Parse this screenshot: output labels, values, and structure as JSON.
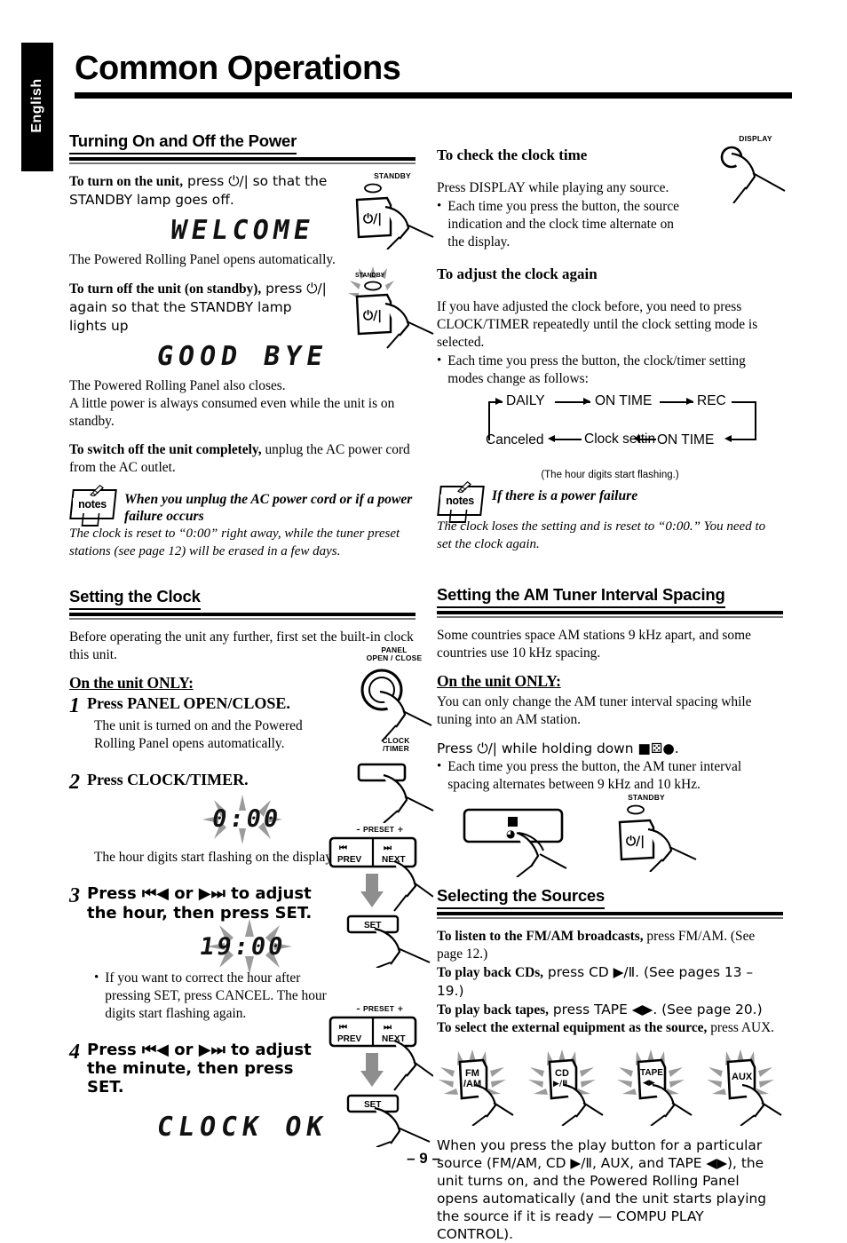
{
  "language_tab": "English",
  "page_title": "Common Operations",
  "page_number": "– 9 –",
  "left_column": {
    "section1": {
      "heading": "Turning On and Off the Power",
      "p1_bold": "To turn on the unit,",
      "p1_rest": " press  ⏻/| so that the STANDBY lamp goes off.",
      "lcd1": "WELCOME",
      "p2": "The Powered Rolling Panel opens automatically.",
      "p3_bold": "To turn off the unit (on standby),",
      "p3_rest": " press  ⏻/| again so that the STANDBY lamp lights up",
      "lcd2": "GOOD BYE",
      "p4": "The Powered Rolling Panel also closes.",
      "p5": "A little power is always consumed even while the unit is on standby.",
      "p6_bold": "To switch off the unit completely,",
      "p6_rest": " unplug the AC power cord from the AC outlet.",
      "note_label": "notes",
      "note_title": "When you unplug the AC power cord or if a power failure occurs",
      "note_body": "The clock is reset to “0:00” right away, while the tuner preset stations (see page 12) will be erased in a few days.",
      "illus_standby_on": "STANDBY",
      "illus_standby_off": "STANDBY"
    },
    "section2": {
      "heading": "Setting the Clock",
      "intro": "Before operating the unit any further, first set the built-in clock this unit.",
      "on_unit_only": "On the unit ONLY:",
      "steps": [
        {
          "num": "1",
          "title": "Press PANEL OPEN/CLOSE.",
          "body": "The unit is turned on and the Powered Rolling Panel opens automatically.",
          "illus_cap": "PANEL\nOPEN / CLOSE"
        },
        {
          "num": "2",
          "title": "Press CLOCK/TIMER.",
          "lcd": "0:00",
          "body": "The hour digits start flashing on the display.",
          "illus_cap": "CLOCK\n/TIMER"
        },
        {
          "num": "3",
          "title": "Press ⏮◀ or ▶⏭ to adjust the hour, then press SET.",
          "lcd": "19:00",
          "bullet": "If you want to correct the hour after pressing SET, press CANCEL. The hour digits start flashing again.",
          "illus_preset": "PRESET",
          "illus_prev": "PREV",
          "illus_next": "NEXT",
          "illus_set": "SET"
        },
        {
          "num": "4",
          "title": "Press  ⏮◀ or ▶⏭ to adjust the minute, then press SET.",
          "lcd": "CLOCK OK",
          "illus_preset": "PRESET",
          "illus_prev": "PREV",
          "illus_next": "NEXT",
          "illus_set": "SET"
        }
      ]
    }
  },
  "right_column": {
    "section1": {
      "heading": "To check the clock time",
      "p1": "Press DISPLAY while playing any source.",
      "bullet1": "Each time you press the button, the source indication and the clock time alternate on the display.",
      "illus_cap": "DISPLAY"
    },
    "section2": {
      "heading": "To adjust the clock again",
      "p1": "If you have adjusted the clock before, you need to press CLOCK/TIMER repeatedly until the clock setting mode is selected.",
      "bullet1": "Each time you press the button, the clock/timer setting modes change as follows:",
      "flow": {
        "top": [
          "DAILY",
          "ON TIME",
          "REC"
        ],
        "bottom": [
          "Canceled",
          "Clock setting",
          "ON TIME"
        ],
        "caption": "(The hour digits start flashing.)"
      },
      "note_label": "notes",
      "note_title": "If there is a power failure",
      "note_body": "The clock loses the setting and is reset to “0:00.” You need to set the clock again."
    },
    "section3": {
      "heading": "Setting the AM Tuner Interval Spacing",
      "p1": "Some countries space AM stations 9 kHz apart, and some countries use 10 kHz spacing.",
      "on_unit_only": "On the unit ONLY:",
      "p2": "You can only change the AM tuner interval spacing while tuning into an AM station.",
      "p3": "Press ⏻/| while holding down ■⚄●.",
      "bullet1": "Each time you press the button, the AM tuner interval spacing alternates between 9 kHz and 10 kHz.",
      "illus_standby": "STANDBY"
    },
    "section4": {
      "heading": "Selecting the Sources",
      "lines": [
        {
          "bold": "To listen to the FM/AM broadcasts,",
          "rest": " press FM/AM. (See page 12.)"
        },
        {
          "bold": "To play back CDs,",
          "rest": " press CD ▶/Ⅱ. (See pages 13 – 19.)"
        },
        {
          "bold": "To play back tapes,",
          "rest": " press TAPE ◀▶. (See page 20.)"
        },
        {
          "bold": "To select the external equipment as the source,",
          "rest": " press AUX."
        }
      ],
      "buttons": [
        {
          "l1": "FM",
          "l2": "/AM"
        },
        {
          "l1": "CD",
          "l2": "▶/Ⅱ"
        },
        {
          "l1": "TAPE",
          "l2": "◀▶"
        },
        {
          "l1": "AUX",
          "l2": ""
        }
      ],
      "closing": "When you press the play button for a particular source (FM/AM, CD ▶/Ⅱ, AUX, and TAPE ◀▶), the unit turns on, and the Powered Rolling Panel opens automatically (and the unit starts playing the source if it is ready — COMPU PLAY CONTROL)."
    }
  }
}
